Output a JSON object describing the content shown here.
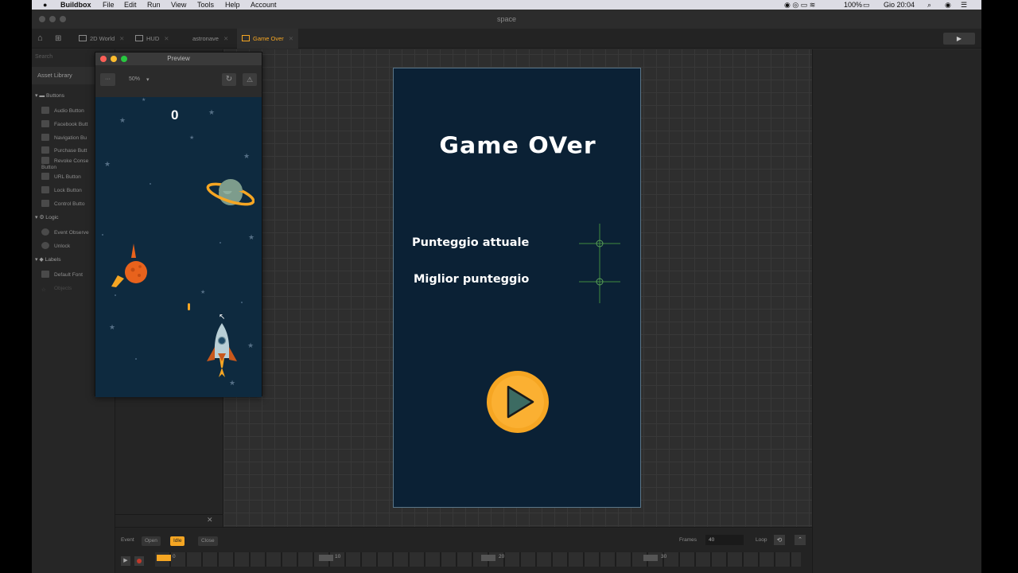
{
  "menubar": {
    "app": "Buildbox",
    "items": [
      "File",
      "Edit",
      "Run",
      "View",
      "Tools",
      "Help",
      "Account"
    ],
    "battery": "100%",
    "clock": "Gio 20:04"
  },
  "window": {
    "title": "space"
  },
  "tabs": [
    {
      "label": "2D World"
    },
    {
      "label": "HUD"
    },
    {
      "label": "astronave"
    },
    {
      "label": "Game Over"
    }
  ],
  "sidebar": {
    "search_placeholder": "Search",
    "section": "Asset Library",
    "groups": [
      {
        "label": "Buttons",
        "items": [
          "Audio Button",
          "Facebook Butt",
          "Navigation Bu",
          "Purchase Butt",
          "Revoke Conse Button",
          "URL Button",
          "Lock Button",
          "Control Butto"
        ]
      },
      {
        "label": "Logic",
        "items": [
          "Event Observe",
          "Unlock"
        ]
      },
      {
        "label": "Labels",
        "items": [
          "Default Font",
          "Objects"
        ]
      }
    ]
  },
  "preview": {
    "title": "Preview",
    "zoom": "50%",
    "score": "0"
  },
  "gameover": {
    "title": "Game OVer",
    "label_current": "Punteggio attuale",
    "label_best": "Miglior punteggio"
  },
  "timeline": {
    "event_label": "Event",
    "events": [
      "Open",
      "Idle",
      "Close"
    ],
    "active_event": "Idle",
    "frames_label": "Frames",
    "frames_value": "40",
    "loop_label": "Loop",
    "ticks": [
      "0",
      "10",
      "20",
      "30"
    ]
  },
  "colors": {
    "accent": "#f5a623",
    "game_bg": "#0b2135",
    "play_button": "#f6a623"
  }
}
